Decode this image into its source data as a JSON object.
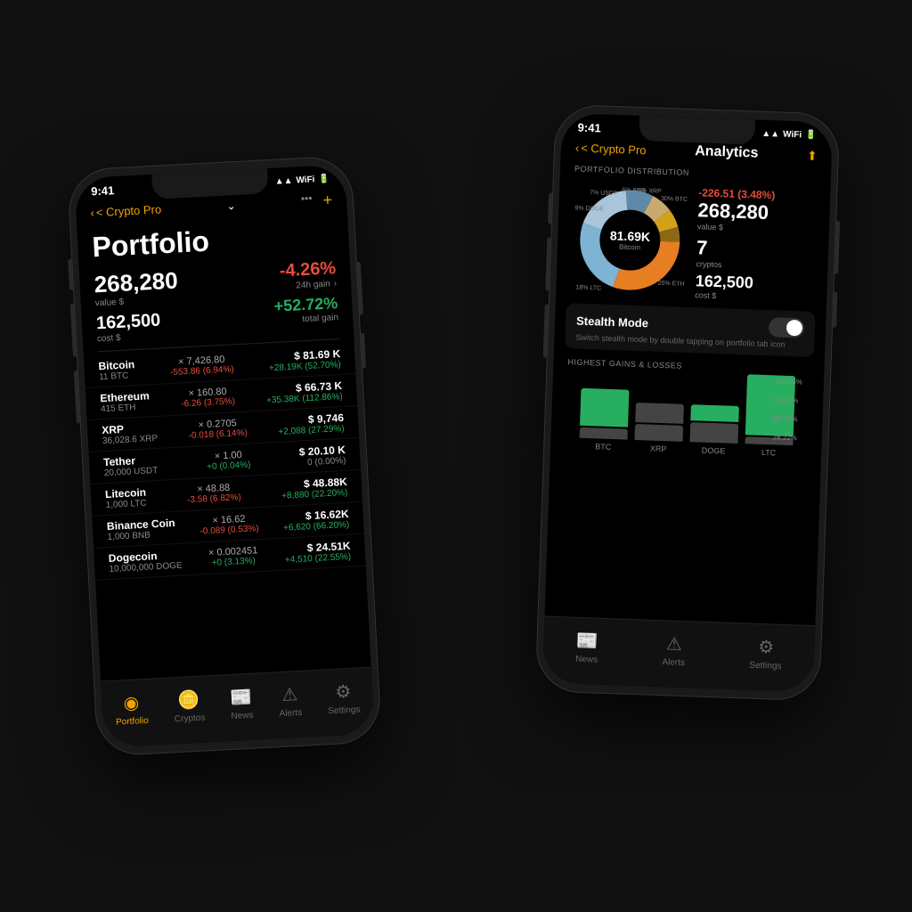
{
  "leftPhone": {
    "status": {
      "time": "9:41",
      "icons": "▲▲ ◀ ▮"
    },
    "nav": {
      "back": "< Crypto Pro",
      "chevron": "⌄",
      "dots": "•••",
      "plus": "+"
    },
    "title": "Portfolio",
    "summary": {
      "value": "268,280",
      "valueLabel": "value $",
      "cost": "162,500",
      "costLabel": "cost $",
      "gain24h": "-4.26%",
      "gain24hLabel": "24h gain",
      "totalGain": "+52.72%",
      "totalGainLabel": "total gain"
    },
    "coins": [
      {
        "name": "Bitcoin",
        "amount": "11 BTC",
        "priceLabel": "× 7,426.80",
        "change": "-553.86 (6.94%)",
        "changeType": "red",
        "value": "$ 81.69 K",
        "gain": "+28.19K (52.70%)",
        "gainType": "green"
      },
      {
        "name": "Ethereum",
        "amount": "415 ETH",
        "priceLabel": "× 160.80",
        "change": "-6.26 (3.75%)",
        "changeType": "red",
        "value": "$ 66.73 K",
        "gain": "+35.38K (112.86%)",
        "gainType": "green"
      },
      {
        "name": "XRP",
        "amount": "36,028.6 XRP",
        "priceLabel": "× 0.2705",
        "change": "-0.018 (6.14%)",
        "changeType": "red",
        "value": "$ 9,746",
        "gain": "+2,088 (27.29%)",
        "gainType": "green"
      },
      {
        "name": "Tether",
        "amount": "20,000 USDT",
        "priceLabel": "× 1.00",
        "change": "+0 (0.04%)",
        "changeType": "green",
        "value": "$ 20.10 K",
        "gain": "0 (0.00%)",
        "gainType": "gray"
      },
      {
        "name": "Litecoin",
        "amount": "1,000 LTC",
        "priceLabel": "× 48.88",
        "change": "-3.58 (6.82%)",
        "changeType": "red",
        "value": "$ 48.88K",
        "gain": "+8,880 (22.20%)",
        "gainType": "green"
      },
      {
        "name": "Binance Coin",
        "amount": "1,000 BNB",
        "priceLabel": "× 16.62",
        "change": "-0.089 (0.53%)",
        "changeType": "red",
        "value": "$ 16.62K",
        "gain": "+6,620 (66.20%)",
        "gainType": "green"
      },
      {
        "name": "Dogecoin",
        "amount": "10,000,000 DOGE",
        "priceLabel": "× 0.002451",
        "change": "+0 (3.13%)",
        "changeType": "green",
        "value": "$ 24.51K",
        "gain": "+4,510 (22.55%)",
        "gainType": "green"
      }
    ],
    "tabs": [
      {
        "label": "Portfolio",
        "icon": "◉",
        "active": true
      },
      {
        "label": "Cryptos",
        "icon": "🪙",
        "active": false
      },
      {
        "label": "News",
        "icon": "📰",
        "active": false
      },
      {
        "label": "Alerts",
        "icon": "⚠",
        "active": false
      },
      {
        "label": "Settings",
        "icon": "⚙",
        "active": false
      }
    ]
  },
  "rightPhone": {
    "status": {
      "time": "9:41",
      "icons": "▲▲ ◀ ▮"
    },
    "nav": {
      "back": "< Crypto Pro",
      "title": "Analytics",
      "shareIcon": "⬆"
    },
    "portfolioDistributionLabel": "PORTFOLIO DISTRIBUTION",
    "donut": {
      "centerValue": "81.69K",
      "centerLabel": "Bitcoin",
      "segments": [
        {
          "label": "30% BTC",
          "color": "#e67e22",
          "pct": 30
        },
        {
          "label": "25% ETH",
          "color": "#7fb3d3",
          "pct": 25
        },
        {
          "label": "18% LTC",
          "color": "#a8c5da",
          "pct": 18
        },
        {
          "label": "9% DOGE",
          "color": "#5d8aa8",
          "pct": 9
        },
        {
          "label": "7% USDT",
          "color": "#c8a96e",
          "pct": 7
        },
        {
          "label": "6% BNB",
          "color": "#d4a017",
          "pct": 6
        },
        {
          "label": "5% XRP",
          "color": "#8b6914",
          "pct": 5
        }
      ]
    },
    "stats": {
      "negative": "-226.51 (3.48%)",
      "value": "268,280",
      "valueLabel": "value $",
      "cryptos": "7",
      "cryptosLabel": "cryptos",
      "cost": "162,500",
      "costLabel": "cost $"
    },
    "stealthMode": {
      "title": "Stealth Mode",
      "desc": "Switch stealth mode by double tapping on portfolio tab icon",
      "enabled": false
    },
    "highestGainsLabel": "HIGHEST GAINS & LOSSES",
    "bars": [
      {
        "label": "BTC",
        "value": 52,
        "color": "#27ae60"
      },
      {
        "label": "XRP",
        "value": 27,
        "color": "#444"
      },
      {
        "label": "DOGE",
        "value": 22,
        "color": "#27ae60"
      },
      {
        "label": "LTC",
        "value": 112,
        "color": "#27ae60"
      }
    ],
    "barPctLabels": [
      "112.86%",
      "84.65%",
      "56.43%",
      "28.22%"
    ],
    "tabs": [
      {
        "label": "News",
        "icon": "📰"
      },
      {
        "label": "Alerts",
        "icon": "⚠"
      },
      {
        "label": "Settings",
        "icon": "⚙"
      }
    ]
  }
}
